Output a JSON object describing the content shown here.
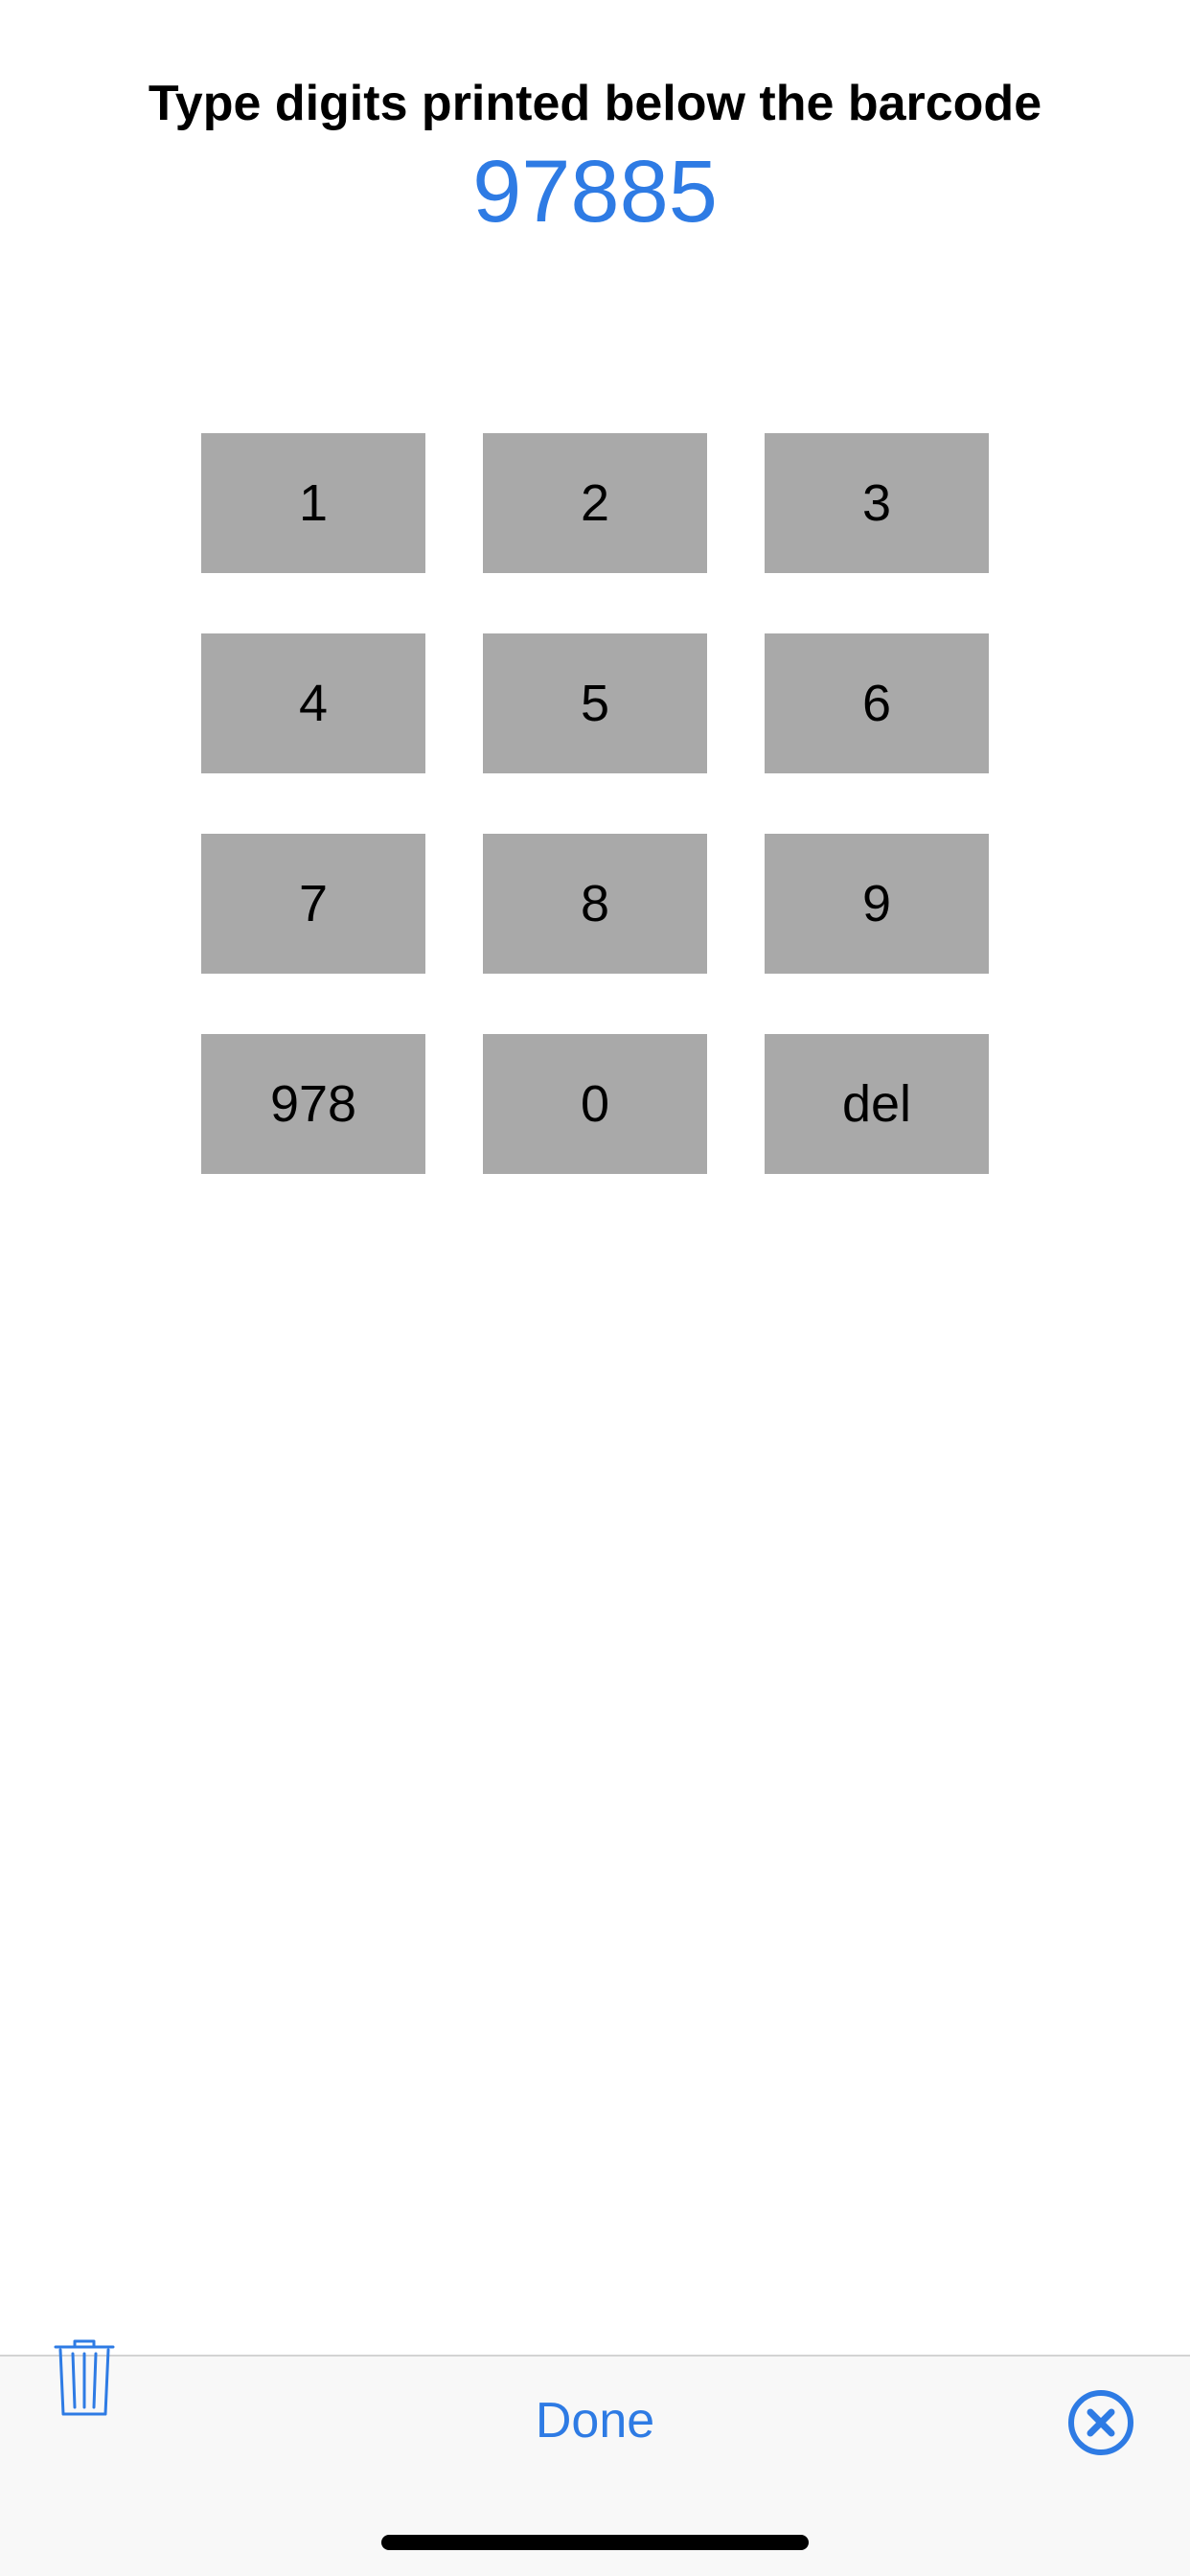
{
  "header": {
    "instruction": "Type digits printed below the barcode",
    "entered_value": "97885"
  },
  "keypad": {
    "keys": [
      "1",
      "2",
      "3",
      "4",
      "5",
      "6",
      "7",
      "8",
      "9",
      "978",
      "0",
      "del"
    ]
  },
  "toolbar": {
    "done_label": "Done",
    "trash_icon": "trash-icon",
    "close_icon": "close-circle-icon"
  },
  "colors": {
    "accent": "#2e7be4",
    "key_background": "#a9a9a9",
    "toolbar_background": "#f8f8f8"
  }
}
